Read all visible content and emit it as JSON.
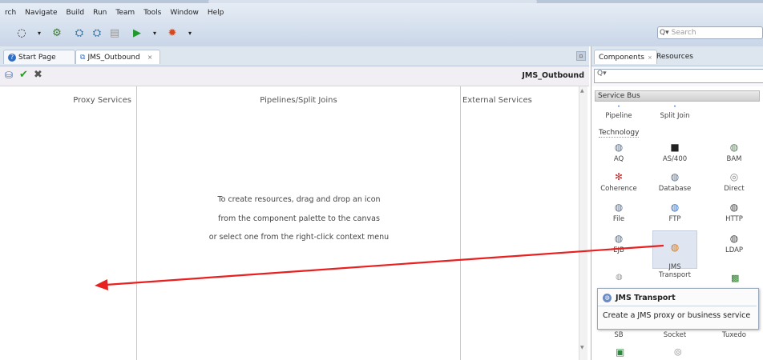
{
  "menu": [
    "rch",
    "Navigate",
    "Build",
    "Run",
    "Team",
    "Tools",
    "Window",
    "Help"
  ],
  "search": {
    "placeholder": "Search",
    "prefix": "Q▾"
  },
  "tabs": [
    {
      "label": "Start Page",
      "icon": "help-circle-icon"
    },
    {
      "label": "JMS_Outbound",
      "icon": "composite-icon"
    }
  ],
  "editor": {
    "title": "JMS_Outbound"
  },
  "canvas": {
    "columns": [
      "Proxy Services",
      "Pipelines/Split Joins",
      "External Services"
    ],
    "hint_lines": [
      "To create resources, drag and drop an icon",
      "from the component palette to the canvas",
      "or select one from the right-click context menu"
    ]
  },
  "palette": {
    "tabs": [
      "Components",
      "Resources"
    ],
    "search_prefix": "Q▾",
    "service_bus": "Service Bus",
    "service_bus_items": [
      "Pipeline",
      "Split Join"
    ],
    "technology_label": "Technology",
    "technology_items": [
      "AQ",
      "AS/400",
      "BAM",
      "Coherence",
      "Database",
      "Direct",
      "File",
      "FTP",
      "HTTP",
      "EJB",
      "JMS\nTransport",
      "LDAP"
    ],
    "bottom_items": [
      "SB",
      "Socket",
      "Tuxedo"
    ]
  },
  "tooltip": {
    "title": "JMS Transport",
    "body": "Create a JMS proxy or business service"
  },
  "colors": {
    "accent_arrow": "#e82020",
    "selection": "#dfe6f2"
  }
}
